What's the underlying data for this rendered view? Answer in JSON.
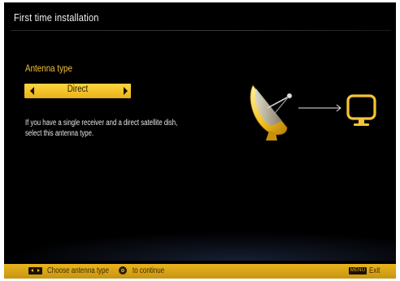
{
  "header": {
    "title": "First time installation"
  },
  "antenna": {
    "label": "Antenna type",
    "selected_value": "Direct",
    "description": "If you have a single receiver and a direct satellite dish, select this antenna type."
  },
  "illustration": {
    "icons": [
      "satellite-dish-icon",
      "arrow-right-icon",
      "tv-monitor-icon"
    ]
  },
  "footer": {
    "hint_choose": "Choose antenna type",
    "hint_continue": "to continue",
    "menu_key_label": "MENU",
    "hint_exit": "Exit"
  },
  "colors": {
    "accent": "#f2c23a",
    "background": "#000000",
    "bar": "#e8b41e"
  }
}
